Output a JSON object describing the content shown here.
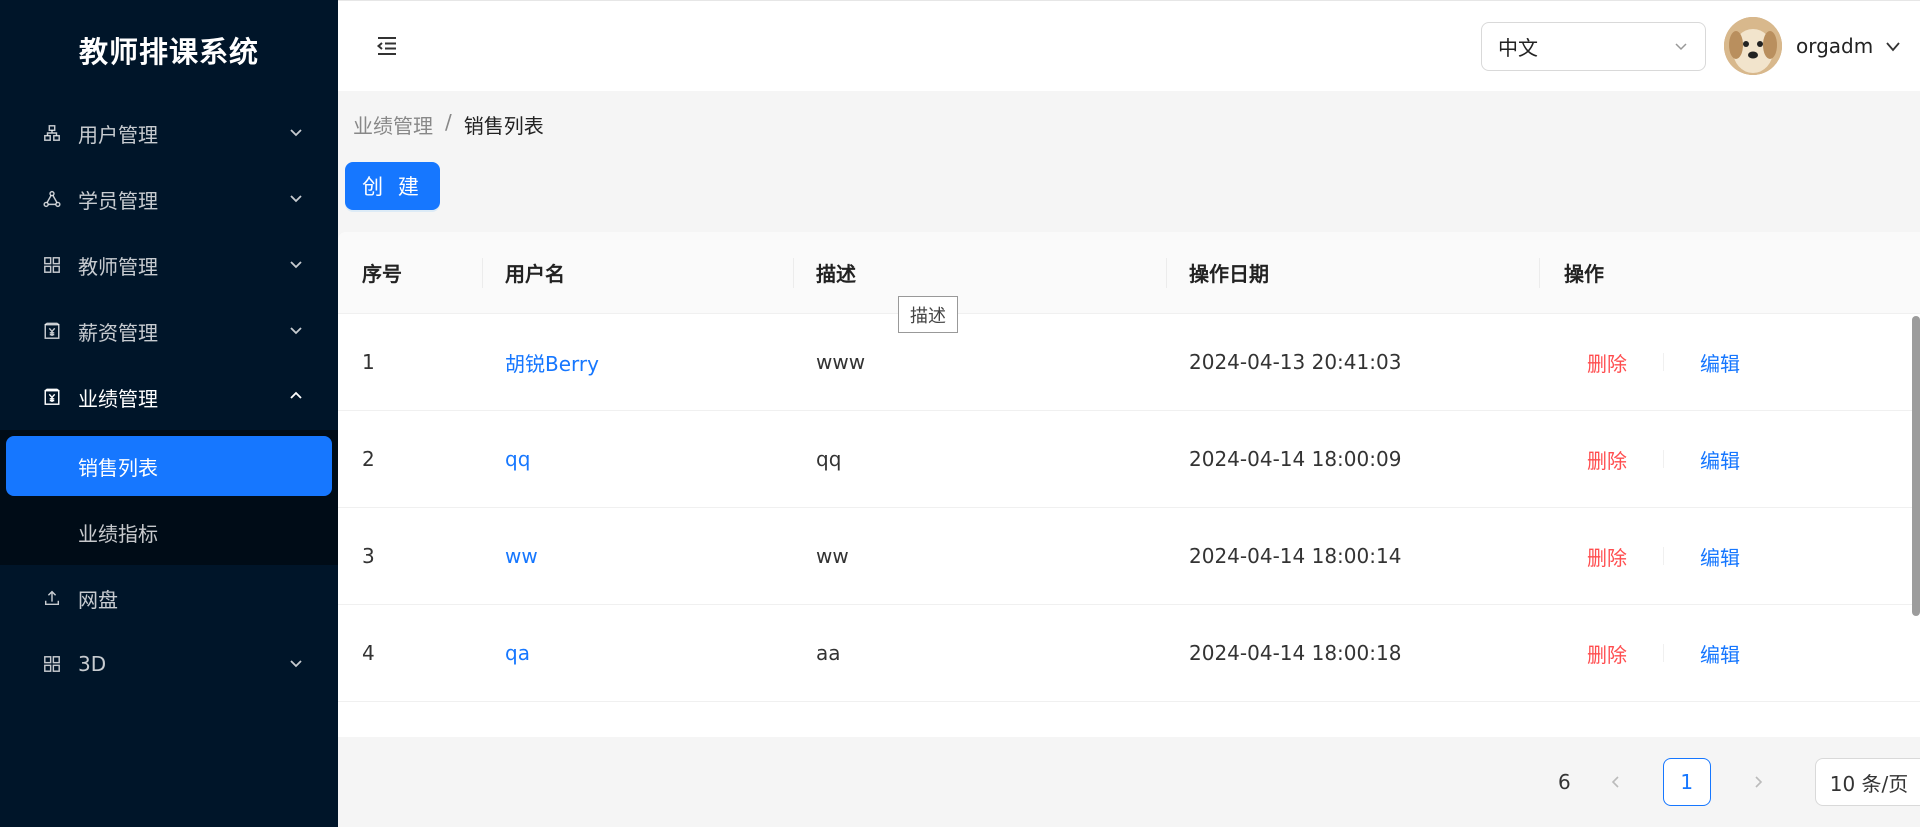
{
  "app": {
    "title": "教师排课系统"
  },
  "sidebar": {
    "items": [
      {
        "label": "用户管理",
        "icon": "org-icon"
      },
      {
        "label": "学员管理",
        "icon": "share-icon"
      },
      {
        "label": "教师管理",
        "icon": "grid-icon"
      },
      {
        "label": "薪资管理",
        "icon": "money-icon"
      },
      {
        "label": "业绩管理",
        "icon": "money-icon",
        "open": true,
        "children": [
          {
            "label": "销售列表",
            "active": true
          },
          {
            "label": "业绩指标"
          }
        ]
      },
      {
        "label": "网盘",
        "icon": "upload-icon"
      },
      {
        "label": "3D",
        "icon": "grid-icon"
      }
    ]
  },
  "header": {
    "language": "中文",
    "username": "orgadm"
  },
  "breadcrumb": {
    "parent": "业绩管理",
    "separator": "/",
    "current": "销售列表"
  },
  "toolbar": {
    "create_label": "创 建"
  },
  "table": {
    "columns": [
      "序号",
      "用户名",
      "描述",
      "操作日期",
      "操作"
    ],
    "rows": [
      {
        "no": "1",
        "username": "胡锐Berry",
        "desc": "www",
        "date": "2024-04-13 20:41:03"
      },
      {
        "no": "2",
        "username": "qq",
        "desc": "qq",
        "date": "2024-04-14 18:00:09"
      },
      {
        "no": "3",
        "username": "ww",
        "desc": "ww",
        "date": "2024-04-14 18:00:14"
      },
      {
        "no": "4",
        "username": "qa",
        "desc": "aa",
        "date": "2024-04-14 18:00:18"
      }
    ],
    "delete_label": "删除",
    "edit_label": "编辑"
  },
  "tooltip": {
    "text": "描述"
  },
  "pagination": {
    "total": "6",
    "current_page": "1",
    "page_size": "10 条/页"
  },
  "colors": {
    "sidebar_bg": "#001529",
    "primary": "#1677ff",
    "danger": "#ff4d4f"
  }
}
